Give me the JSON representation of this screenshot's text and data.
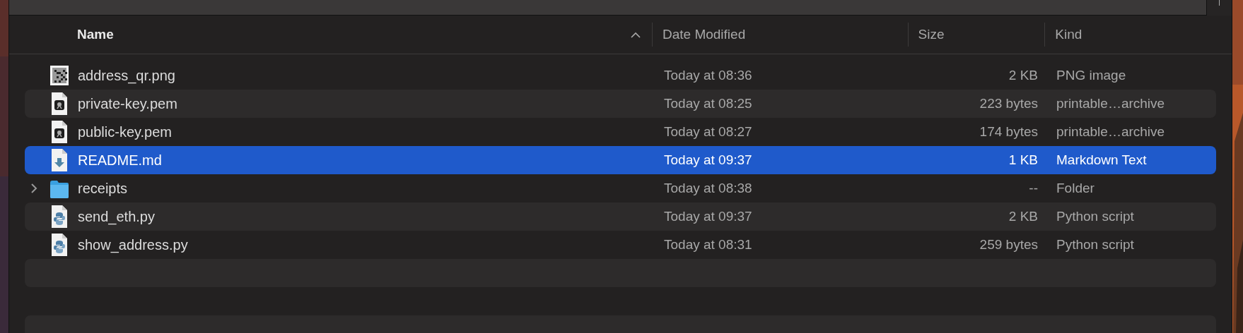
{
  "table": {
    "columns": [
      {
        "label": "Name",
        "sorted": true
      },
      {
        "label": "Date Modified",
        "sorted": false
      },
      {
        "label": "Size",
        "sorted": false
      },
      {
        "label": "Kind",
        "sorted": false
      }
    ],
    "rows": [
      {
        "name": "address_qr.png",
        "date": "Today at 08:36",
        "size": "2 KB",
        "file_kind": "PNG image",
        "selected": false
      },
      {
        "name": "private-key.pem",
        "date": "Today at 08:25",
        "size": "223 bytes",
        "file_kind": "printable…archive",
        "kind": "certificate",
        "selected": false
      },
      {
        "name": "public-key.pem",
        "date": "Today at 08:27",
        "size": "174 bytes",
        "file_kind": "printable…archive",
        "kind": "certificate",
        "selected": false
      },
      {
        "name": "README.md",
        "date": "Today at 09:37",
        "size": "1 KB",
        "file_kind": "Markdown Text",
        "kind": "markdown",
        "selected": true
      },
      {
        "name": "receipts",
        "date": "Today at 08:38",
        "size": "--",
        "file_kind": "Folder",
        "kind": "folder",
        "selected": false,
        "expanded": false
      },
      {
        "name": "send_eth.py",
        "date": "Today at 09:37",
        "size": "2 KB",
        "file_kind": "Python script",
        "kind": "python",
        "selected": false
      },
      {
        "name": "show_address.py",
        "date": "Today at 08:31",
        "size": "259 bytes",
        "file_kind": "Python script",
        "kind": "python",
        "selected": false
      }
    ]
  }
}
